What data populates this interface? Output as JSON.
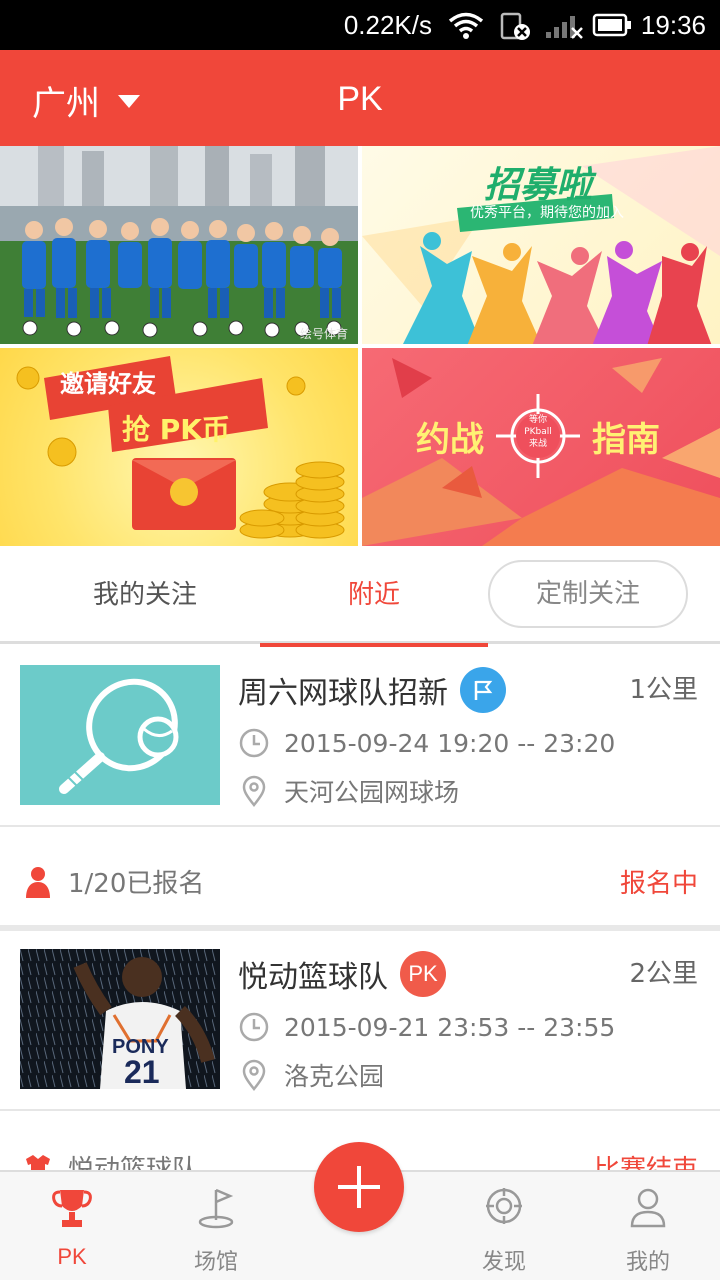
{
  "status_bar": {
    "speed": "0.22K/s",
    "time": "19:36"
  },
  "header": {
    "city": "广州",
    "title": "PK"
  },
  "banners": {
    "recruit_title": "招募啦",
    "recruit_sub": "优秀平台，期待您的加入",
    "invite_line1": "邀请好友",
    "invite_line2": "抢 PK币",
    "guide_left": "约战",
    "guide_right": "指南",
    "guide_center": "等你PKball来战",
    "photo_watermark": "绘号体育"
  },
  "tabs": {
    "follow": "我的关注",
    "nearby": "附近",
    "custom": "定制关注"
  },
  "feed": [
    {
      "title": "周六网球队招新",
      "badge": "flag-icon",
      "distance": "1公里",
      "time": "2015-09-24 19:20 -- 23:20",
      "location": "天河公园网球场",
      "signup": "1/20已报名",
      "state": "报名中",
      "thumb_color": "#6ccbc9"
    },
    {
      "title": "悦动篮球队",
      "badge_text": "PK",
      "distance": "2公里",
      "time": "2015-09-21 23:53 -- 23:55",
      "location": "洛克公园",
      "jersey_number": "21",
      "jersey_text": "PONY"
    }
  ],
  "peek": {
    "title": "悦动篮球队",
    "state": "比赛结束"
  },
  "nav": {
    "pk": "PK",
    "venue": "场馆",
    "discover": "发现",
    "mine": "我的"
  },
  "colors": {
    "accent": "#f0473a",
    "teal": "#6ccbc9"
  }
}
